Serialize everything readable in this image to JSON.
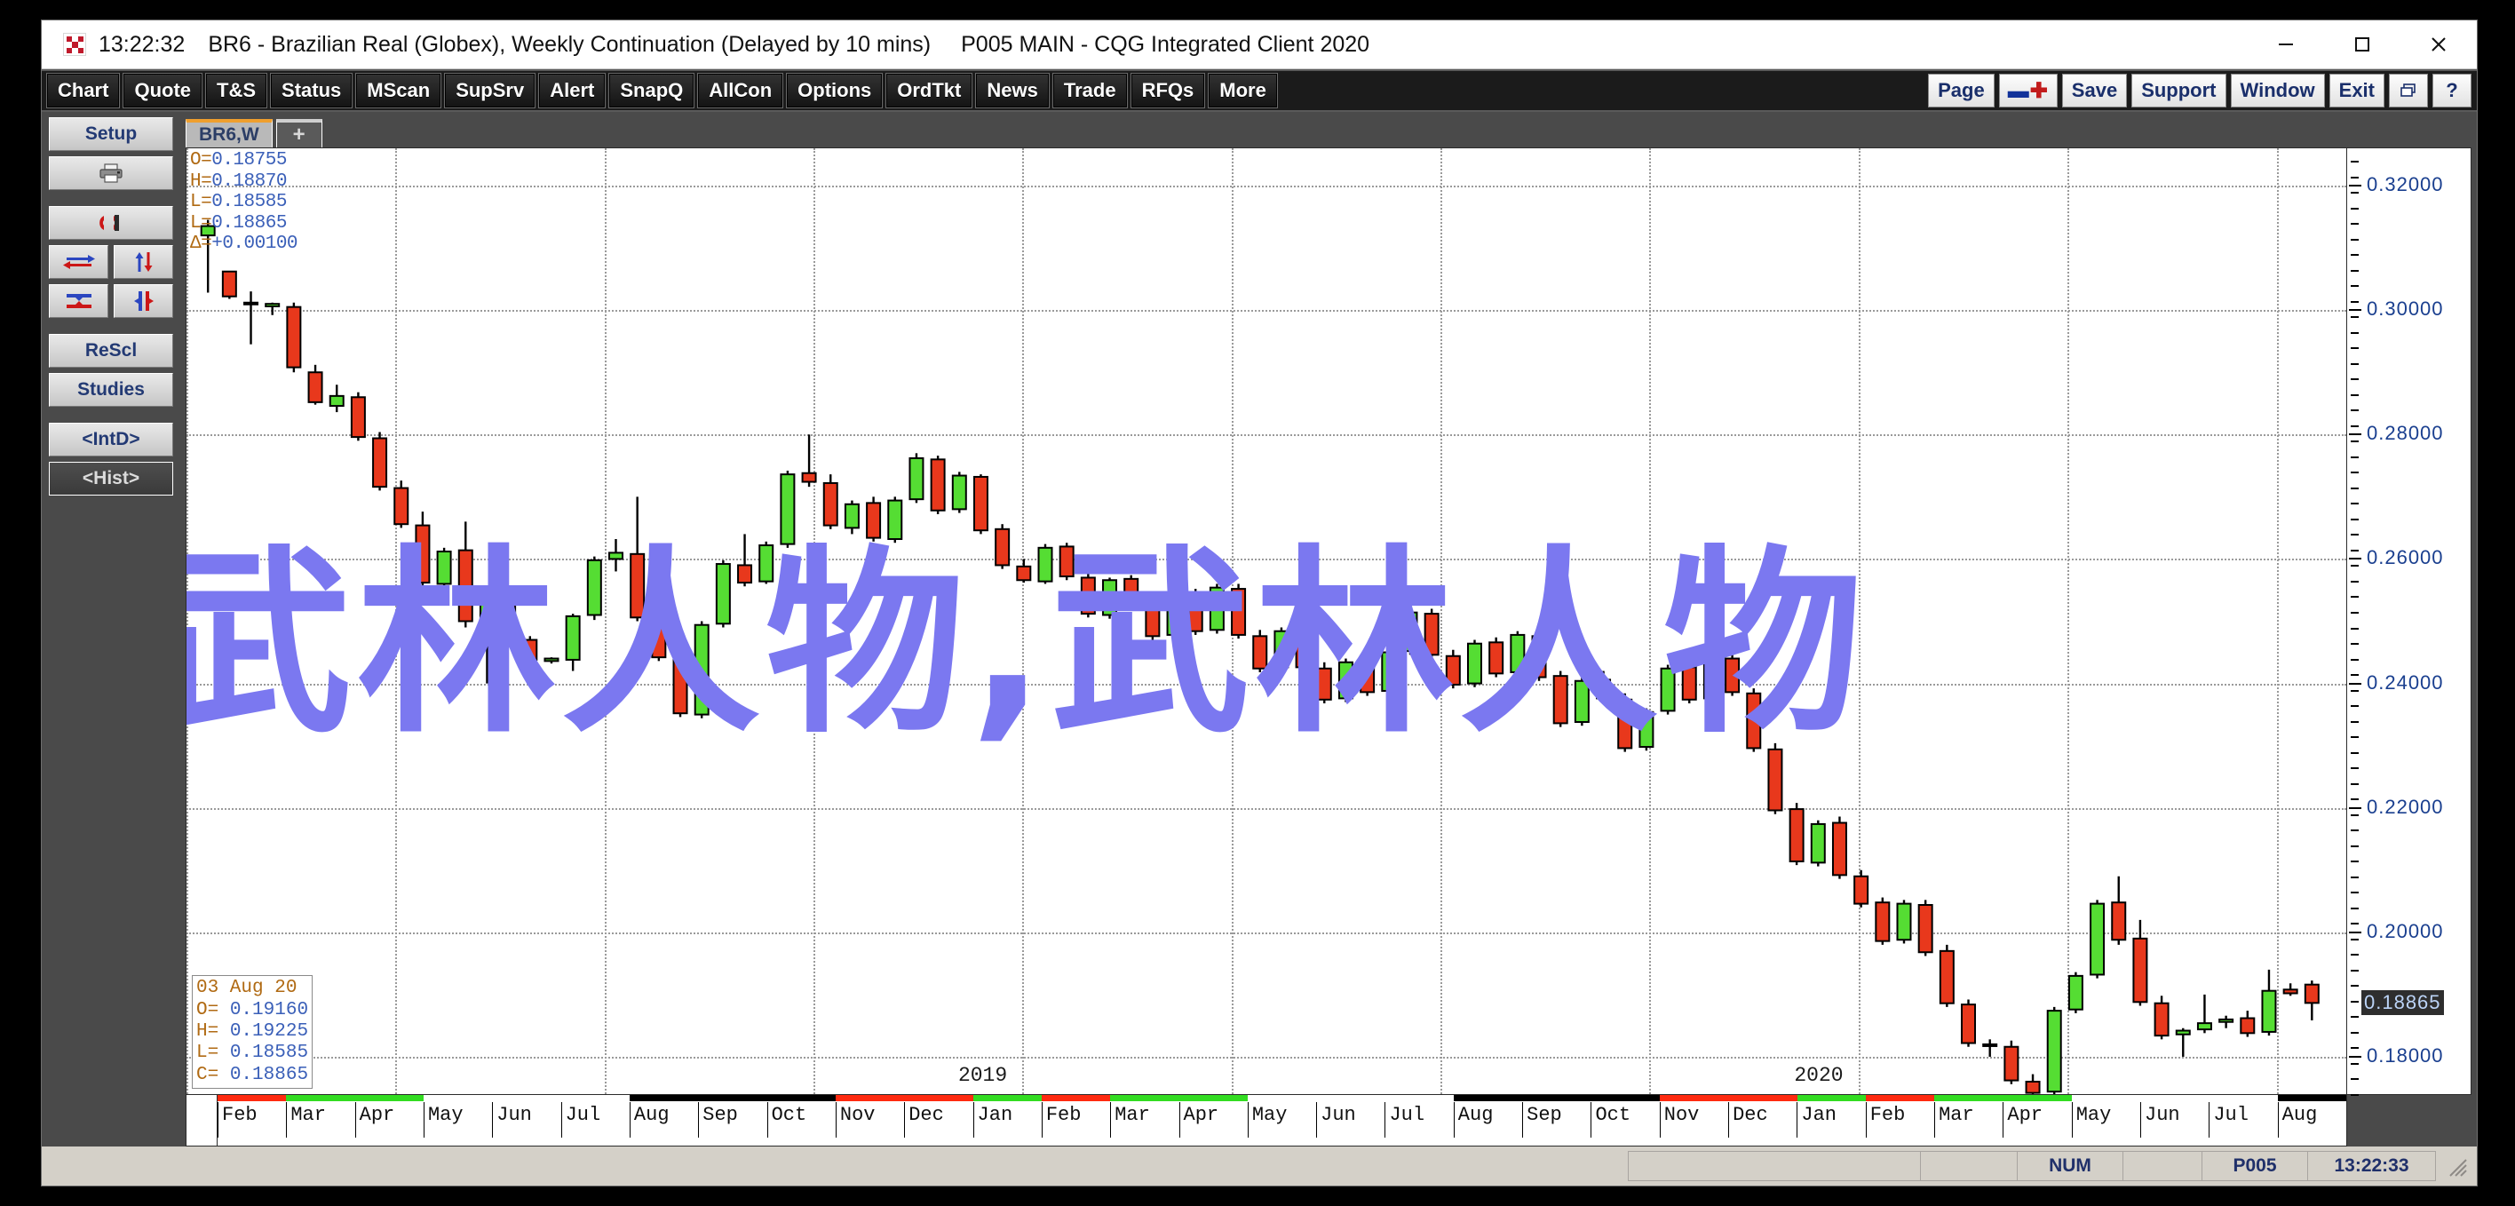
{
  "window": {
    "time": "13:22:32",
    "title": "BR6 - Brazilian Real (Globex), Weekly Continuation (Delayed by 10 mins)",
    "subtitle": "P005 MAIN - CQG Integrated Client 2020",
    "app_icon": "cqg-logo-icon",
    "minimize": "minimize-icon",
    "maximize": "maximize-icon",
    "close": "close-icon"
  },
  "menubar": {
    "items": [
      "Chart",
      "Quote",
      "T&S",
      "Status",
      "MScan",
      "SupSrv",
      "Alert",
      "SnapQ",
      "AllCon",
      "Options",
      "OrdTkt",
      "News",
      "Trade",
      "RFQs",
      "More"
    ],
    "right_items": [
      "Page",
      "Save",
      "Support",
      "Window",
      "Exit"
    ],
    "plus_minus": "-+",
    "restore_icon": "restore-window-icon",
    "help_icon": "question-mark-icon"
  },
  "sidebar": {
    "setup": "Setup",
    "print_icon": "printer-icon",
    "magnet_icon": "magnet-icon",
    "arrow_left_right_icon": "arrow-left-right-icon",
    "arrow_up_down_icon": "arrow-up-down-icon",
    "collapse_vertical_icon": "collapse-vertical-icon",
    "expand_horizontal_icon": "expand-horizontal-icon",
    "rescale": "ReScl",
    "studies": "Studies",
    "intraday": "<IntD>",
    "history": "<Hist>"
  },
  "tabs": {
    "active": "BR6,W",
    "add": "+"
  },
  "quote": {
    "open_label": "O=",
    "open": "0.18755",
    "high_label": "H=",
    "high": "0.18870",
    "low_label": "L=",
    "low": "0.18585",
    "last_label": "L=",
    "last": "0.18865",
    "delta_label": "Δ=",
    "delta": "+0.00100"
  },
  "databox": {
    "date": "03 Aug 20",
    "open_label": "O=",
    "open": "0.19160",
    "high_label": "H=",
    "high": "0.19225",
    "low_label": "L=",
    "low": "0.18585",
    "close_label": "C=",
    "close": "0.18865"
  },
  "watermark": {
    "text": "武林人物,武林人物",
    "color": "#7b78f0"
  },
  "statusbar": {
    "num": "NUM",
    "page": "P005",
    "time": "13:22:33"
  },
  "chart_data": {
    "type": "candlestick",
    "title": "BR6 - Brazilian Real (Globex), Weekly Continuation",
    "ylabel": "",
    "xlabel": "",
    "ylim": [
      0.174,
      0.326
    ],
    "grid": true,
    "y_ticks": [
      "0.32000",
      "0.30000",
      "0.28000",
      "0.26000",
      "0.24000",
      "0.22000",
      "0.20000",
      "0.18000"
    ],
    "y_tick_values": [
      0.32,
      0.3,
      0.28,
      0.26,
      0.24,
      0.22,
      0.2,
      0.18
    ],
    "current_price_label": "0.18865",
    "current_price": 0.18865,
    "year_labels": [
      "2019",
      "2020"
    ],
    "month_labels": [
      "Feb",
      "Mar",
      "Apr",
      "May",
      "Jun",
      "Jul",
      "Aug",
      "Sep",
      "Oct",
      "Nov",
      "Dec",
      "Jan",
      "Feb",
      "Mar",
      "Apr",
      "May",
      "Jun",
      "Jul",
      "Aug",
      "Sep",
      "Oct",
      "Nov",
      "Dec",
      "Jan",
      "Feb",
      "Mar",
      "Apr",
      "May",
      "Jun",
      "Jul",
      "Aug"
    ],
    "up_color": "#55dd33",
    "down_color": "#e8381c",
    "wick_color": "#000000",
    "series_name": "BR6 Weekly",
    "candles": [
      {
        "o": 0.312,
        "h": 0.3145,
        "l": 0.3028,
        "c": 0.3135
      },
      {
        "o": 0.3062,
        "h": 0.3062,
        "l": 0.3018,
        "c": 0.3022
      },
      {
        "o": 0.3012,
        "h": 0.303,
        "l": 0.2945,
        "c": 0.301
      },
      {
        "o": 0.3006,
        "h": 0.3012,
        "l": 0.2992,
        "c": 0.301
      },
      {
        "o": 0.3005,
        "h": 0.3012,
        "l": 0.29,
        "c": 0.2908
      },
      {
        "o": 0.29,
        "h": 0.2912,
        "l": 0.2848,
        "c": 0.2852
      },
      {
        "o": 0.2846,
        "h": 0.288,
        "l": 0.2836,
        "c": 0.2862
      },
      {
        "o": 0.286,
        "h": 0.2868,
        "l": 0.279,
        "c": 0.2796
      },
      {
        "o": 0.2794,
        "h": 0.2804,
        "l": 0.271,
        "c": 0.2716
      },
      {
        "o": 0.2714,
        "h": 0.2726,
        "l": 0.265,
        "c": 0.2656
      },
      {
        "o": 0.2654,
        "h": 0.2676,
        "l": 0.2556,
        "c": 0.2562
      },
      {
        "o": 0.256,
        "h": 0.2618,
        "l": 0.255,
        "c": 0.2612
      },
      {
        "o": 0.2614,
        "h": 0.266,
        "l": 0.249,
        "c": 0.25
      },
      {
        "o": 0.2498,
        "h": 0.254,
        "l": 0.24,
        "c": 0.2536
      },
      {
        "o": 0.2538,
        "h": 0.2548,
        "l": 0.247,
        "c": 0.2474
      },
      {
        "o": 0.247,
        "h": 0.2476,
        "l": 0.2432,
        "c": 0.2438
      },
      {
        "o": 0.2436,
        "h": 0.2442,
        "l": 0.2432,
        "c": 0.244
      },
      {
        "o": 0.2438,
        "h": 0.2512,
        "l": 0.242,
        "c": 0.2508
      },
      {
        "o": 0.251,
        "h": 0.2604,
        "l": 0.2502,
        "c": 0.2598
      },
      {
        "o": 0.26,
        "h": 0.2632,
        "l": 0.258,
        "c": 0.261
      },
      {
        "o": 0.2608,
        "h": 0.27,
        "l": 0.25,
        "c": 0.2506
      },
      {
        "o": 0.2504,
        "h": 0.2512,
        "l": 0.2436,
        "c": 0.2442
      },
      {
        "o": 0.244,
        "h": 0.2448,
        "l": 0.2346,
        "c": 0.2352
      },
      {
        "o": 0.235,
        "h": 0.25,
        "l": 0.2344,
        "c": 0.2494
      },
      {
        "o": 0.2496,
        "h": 0.2598,
        "l": 0.249,
        "c": 0.2592
      },
      {
        "o": 0.259,
        "h": 0.264,
        "l": 0.2556,
        "c": 0.2562
      },
      {
        "o": 0.2564,
        "h": 0.2628,
        "l": 0.256,
        "c": 0.2622
      },
      {
        "o": 0.2624,
        "h": 0.2742,
        "l": 0.2618,
        "c": 0.2736
      },
      {
        "o": 0.2738,
        "h": 0.28,
        "l": 0.2716,
        "c": 0.2724
      },
      {
        "o": 0.2722,
        "h": 0.2736,
        "l": 0.2648,
        "c": 0.2654
      },
      {
        "o": 0.265,
        "h": 0.2694,
        "l": 0.264,
        "c": 0.2688
      },
      {
        "o": 0.269,
        "h": 0.27,
        "l": 0.2628,
        "c": 0.2634
      },
      {
        "o": 0.2632,
        "h": 0.27,
        "l": 0.2626,
        "c": 0.2694
      },
      {
        "o": 0.2696,
        "h": 0.277,
        "l": 0.269,
        "c": 0.2762
      },
      {
        "o": 0.276,
        "h": 0.2766,
        "l": 0.2672,
        "c": 0.2678
      },
      {
        "o": 0.268,
        "h": 0.274,
        "l": 0.2674,
        "c": 0.2734
      },
      {
        "o": 0.2732,
        "h": 0.2736,
        "l": 0.264,
        "c": 0.2646
      },
      {
        "o": 0.2648,
        "h": 0.2656,
        "l": 0.2584,
        "c": 0.259
      },
      {
        "o": 0.2588,
        "h": 0.26,
        "l": 0.2562,
        "c": 0.2566
      },
      {
        "o": 0.2564,
        "h": 0.2624,
        "l": 0.256,
        "c": 0.2618
      },
      {
        "o": 0.262,
        "h": 0.2626,
        "l": 0.2566,
        "c": 0.2572
      },
      {
        "o": 0.257,
        "h": 0.258,
        "l": 0.2506,
        "c": 0.2512
      },
      {
        "o": 0.251,
        "h": 0.257,
        "l": 0.2504,
        "c": 0.2566
      },
      {
        "o": 0.2568,
        "h": 0.2574,
        "l": 0.252,
        "c": 0.2526
      },
      {
        "o": 0.2524,
        "h": 0.2534,
        "l": 0.247,
        "c": 0.2476
      },
      {
        "o": 0.2478,
        "h": 0.2548,
        "l": 0.2472,
        "c": 0.254
      },
      {
        "o": 0.2542,
        "h": 0.2552,
        "l": 0.2478,
        "c": 0.2484
      },
      {
        "o": 0.2486,
        "h": 0.256,
        "l": 0.248,
        "c": 0.2554
      },
      {
        "o": 0.2552,
        "h": 0.256,
        "l": 0.2472,
        "c": 0.2478
      },
      {
        "o": 0.2476,
        "h": 0.2486,
        "l": 0.2418,
        "c": 0.2424
      },
      {
        "o": 0.2426,
        "h": 0.249,
        "l": 0.242,
        "c": 0.2484
      },
      {
        "o": 0.2486,
        "h": 0.2494,
        "l": 0.242,
        "c": 0.2426
      },
      {
        "o": 0.2424,
        "h": 0.2434,
        "l": 0.2368,
        "c": 0.2374
      },
      {
        "o": 0.2376,
        "h": 0.244,
        "l": 0.237,
        "c": 0.2434
      },
      {
        "o": 0.2436,
        "h": 0.2446,
        "l": 0.238,
        "c": 0.2386
      },
      {
        "o": 0.2388,
        "h": 0.2456,
        "l": 0.2382,
        "c": 0.245
      },
      {
        "o": 0.2452,
        "h": 0.252,
        "l": 0.2446,
        "c": 0.2514
      },
      {
        "o": 0.2512,
        "h": 0.252,
        "l": 0.244,
        "c": 0.2446
      },
      {
        "o": 0.2444,
        "h": 0.2454,
        "l": 0.2392,
        "c": 0.2398
      },
      {
        "o": 0.24,
        "h": 0.247,
        "l": 0.2394,
        "c": 0.2464
      },
      {
        "o": 0.2466,
        "h": 0.2474,
        "l": 0.241,
        "c": 0.2416
      },
      {
        "o": 0.2418,
        "h": 0.2484,
        "l": 0.2412,
        "c": 0.2478
      },
      {
        "o": 0.2476,
        "h": 0.2484,
        "l": 0.2404,
        "c": 0.241
      },
      {
        "o": 0.2412,
        "h": 0.242,
        "l": 0.233,
        "c": 0.2336
      },
      {
        "o": 0.2338,
        "h": 0.241,
        "l": 0.2332,
        "c": 0.2404
      },
      {
        "o": 0.2406,
        "h": 0.242,
        "l": 0.237,
        "c": 0.2376
      },
      {
        "o": 0.2374,
        "h": 0.2384,
        "l": 0.229,
        "c": 0.2296
      },
      {
        "o": 0.2298,
        "h": 0.236,
        "l": 0.2292,
        "c": 0.2354
      },
      {
        "o": 0.2356,
        "h": 0.243,
        "l": 0.235,
        "c": 0.2424
      },
      {
        "o": 0.2426,
        "h": 0.2436,
        "l": 0.2368,
        "c": 0.2374
      },
      {
        "o": 0.2376,
        "h": 0.2444,
        "l": 0.237,
        "c": 0.2438
      },
      {
        "o": 0.244,
        "h": 0.2448,
        "l": 0.238,
        "c": 0.2386
      },
      {
        "o": 0.2384,
        "h": 0.2392,
        "l": 0.229,
        "c": 0.2296
      },
      {
        "o": 0.2294,
        "h": 0.2304,
        "l": 0.219,
        "c": 0.2196
      },
      {
        "o": 0.2198,
        "h": 0.2208,
        "l": 0.2108,
        "c": 0.2114
      },
      {
        "o": 0.2112,
        "h": 0.218,
        "l": 0.2106,
        "c": 0.2174
      },
      {
        "o": 0.2176,
        "h": 0.2186,
        "l": 0.2086,
        "c": 0.2092
      },
      {
        "o": 0.209,
        "h": 0.21,
        "l": 0.204,
        "c": 0.2046
      },
      {
        "o": 0.2048,
        "h": 0.2056,
        "l": 0.198,
        "c": 0.1986
      },
      {
        "o": 0.1988,
        "h": 0.2052,
        "l": 0.1982,
        "c": 0.2046
      },
      {
        "o": 0.2044,
        "h": 0.2052,
        "l": 0.1962,
        "c": 0.1968
      },
      {
        "o": 0.197,
        "h": 0.198,
        "l": 0.188,
        "c": 0.1886
      },
      {
        "o": 0.1884,
        "h": 0.1892,
        "l": 0.1816,
        "c": 0.1822
      },
      {
        "o": 0.182,
        "h": 0.1828,
        "l": 0.18,
        "c": 0.1818
      },
      {
        "o": 0.1816,
        "h": 0.1826,
        "l": 0.1756,
        "c": 0.1762
      },
      {
        "o": 0.176,
        "h": 0.1772,
        "l": 0.1736,
        "c": 0.1742
      },
      {
        "o": 0.1744,
        "h": 0.188,
        "l": 0.174,
        "c": 0.1874
      },
      {
        "o": 0.1876,
        "h": 0.1936,
        "l": 0.187,
        "c": 0.193
      },
      {
        "o": 0.1932,
        "h": 0.2052,
        "l": 0.1926,
        "c": 0.2046
      },
      {
        "o": 0.2048,
        "h": 0.209,
        "l": 0.198,
        "c": 0.1988
      },
      {
        "o": 0.199,
        "h": 0.202,
        "l": 0.1882,
        "c": 0.1888
      },
      {
        "o": 0.1886,
        "h": 0.1898,
        "l": 0.1828,
        "c": 0.1834
      },
      {
        "o": 0.1836,
        "h": 0.1846,
        "l": 0.18,
        "c": 0.1842
      },
      {
        "o": 0.1844,
        "h": 0.19,
        "l": 0.1838,
        "c": 0.1854
      },
      {
        "o": 0.1856,
        "h": 0.1866,
        "l": 0.1846,
        "c": 0.186
      },
      {
        "o": 0.1862,
        "h": 0.1874,
        "l": 0.1832,
        "c": 0.1838
      },
      {
        "o": 0.184,
        "h": 0.194,
        "l": 0.1834,
        "c": 0.1906
      },
      {
        "o": 0.1908,
        "h": 0.1918,
        "l": 0.1898,
        "c": 0.1902
      },
      {
        "o": 0.1916,
        "h": 0.19225,
        "l": 0.18585,
        "c": 0.18865
      }
    ]
  }
}
